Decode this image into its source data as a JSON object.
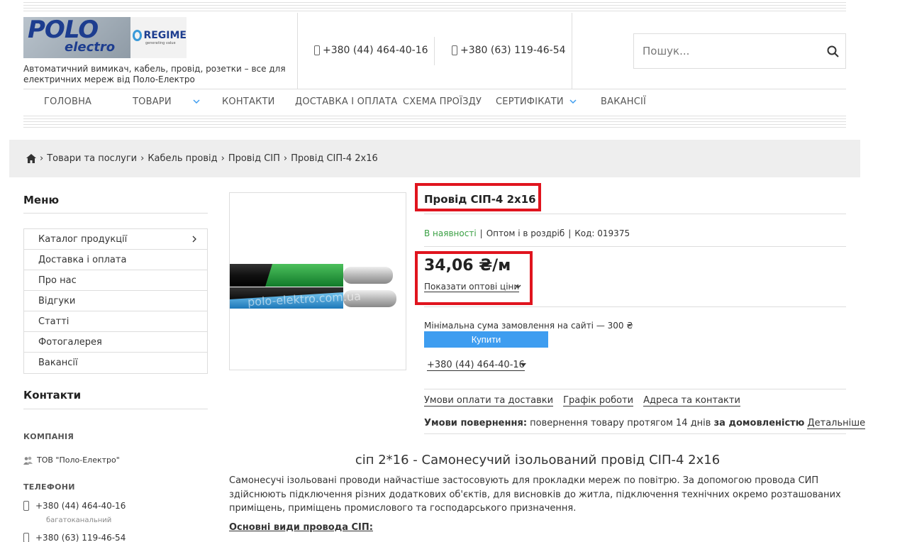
{
  "header": {
    "logo": {
      "brand": "POLO",
      "brand_sub": "electro",
      "partner": "REGIME",
      "partner_sub": "generating value"
    },
    "tagline": "Автоматичний вимикач, кабель, провід, розетки – все для електричних мереж від Поло-Електро",
    "phones": [
      "+380 (44) 464-40-16",
      "+380 (63) 119-46-54"
    ],
    "search": {
      "placeholder": "Пошук..."
    }
  },
  "nav": {
    "items": [
      {
        "label": "ГОЛОВНА",
        "has_dropdown": false
      },
      {
        "label": "ТОВАРИ",
        "has_dropdown": true
      },
      {
        "label": "КОНТАКТИ",
        "has_dropdown": false
      },
      {
        "label": "ДОСТАВКА І ОПЛАТА",
        "has_dropdown": false
      },
      {
        "label": "СХЕМА ПРОЇЗДУ",
        "has_dropdown": false
      },
      {
        "label": "СЕРТИФІКАТИ",
        "has_dropdown": true
      },
      {
        "label": "ВАКАНСІЇ",
        "has_dropdown": false
      }
    ]
  },
  "breadcrumb": {
    "items": [
      "Товари та послуги",
      "Кабель провід",
      "Провід СІП",
      "Провід СІП-4 2х16"
    ],
    "separator": "›"
  },
  "sidebar": {
    "menu_title": "Меню",
    "menu_items": [
      "Каталог продукції",
      "Доставка і оплата",
      "Про нас",
      "Відгуки",
      "Статті",
      "Фотогалерея",
      "Вакансії"
    ],
    "contacts_title": "Контакти",
    "company_label": "КОМПАНІЯ",
    "company_name": "ТОВ \"Поло-Електро\"",
    "phones_label": "ТЕЛЕФОНИ",
    "phones": [
      "+380 (44) 464-40-16",
      "+380 (63) 119-46-54"
    ],
    "phone_note": "багатоканальний"
  },
  "product": {
    "image_watermark": "polo-elektro.com.ua",
    "title": "Провід СІП-4 2х16",
    "availability": "В наявності",
    "sale_type": "Оптом і в роздріб",
    "code": "Код: 019375",
    "price": "34,06 ₴/м",
    "wholesale_link": "Показати оптові ціни",
    "min_order": "Мінімальна сума замовлення на сайті — 300 ₴",
    "buy_label": "Купити",
    "phone_dropdown": "+380 (44) 464-40-16",
    "links": [
      "Умови оплати та доставки",
      "Графік роботи",
      "Адреса та контакти"
    ],
    "returns": {
      "label": "Умови повернення:",
      "text": "повернення товару протягом 14 днів",
      "agreement": "за домовленістю",
      "details": "Детальніше"
    }
  },
  "description": {
    "title": "сіп 2*16 - Самонесучий ізольований провід СІП-4 2х16",
    "text": "Самонесучі ізольовані проводи найчастіше застосовують для прокладки мереж по повітрю. За допомогою провода СИП здійснюють підключення різних додаткових об'єктів, для висновків до житла, підключення технічних окремо розташованих приміщень, приміщень промислового та господарського призначення.",
    "subtitle": "Основні види провода СІП:"
  },
  "colors": {
    "highlight": "#e0141e",
    "buy_button": "#3e9df0",
    "in_stock": "#3aa044",
    "brand_blue": "#1d3d8f"
  }
}
